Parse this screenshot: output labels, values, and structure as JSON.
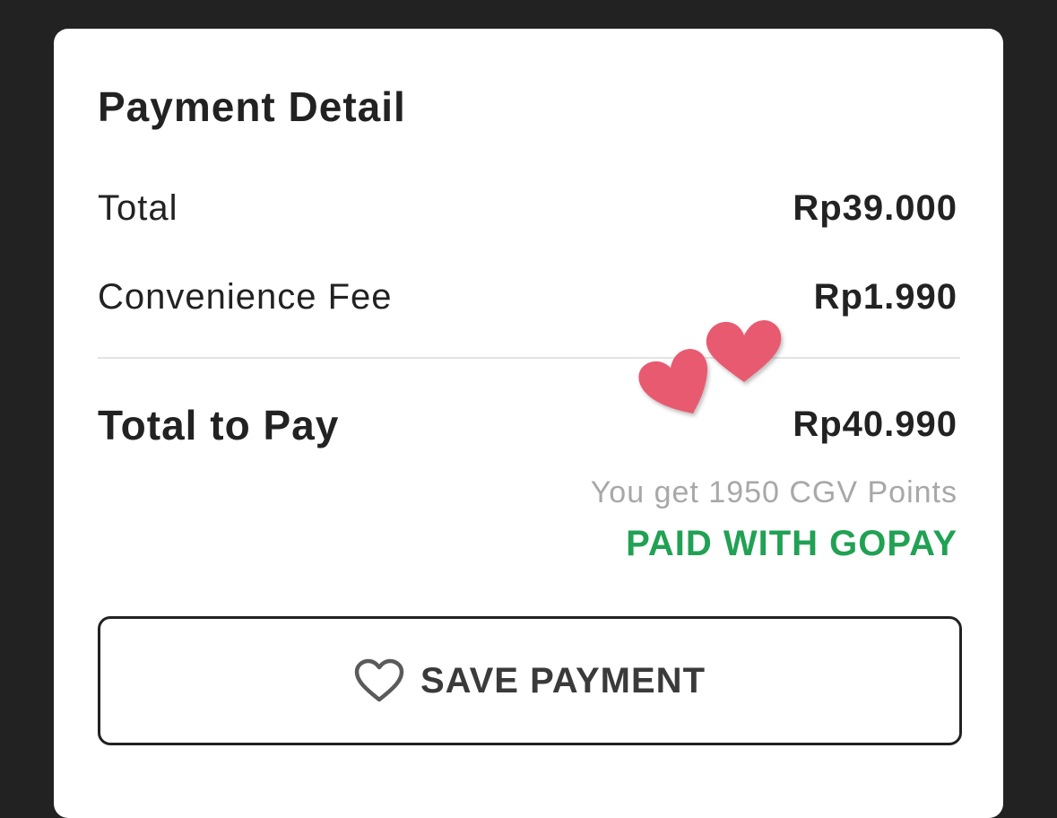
{
  "payment": {
    "title": "Payment Detail",
    "rows": [
      {
        "label": "Total",
        "value": "Rp39.000"
      },
      {
        "label": "Convenience Fee",
        "value": "Rp1.990"
      }
    ],
    "total_label": "Total to Pay",
    "total_value": "Rp40.990",
    "points_text": "You get 1950 CGV Points",
    "paid_text": "PAID WITH GOPAY",
    "save_button": {
      "label": "SAVE PAYMENT",
      "icon": "heart-outline-icon"
    }
  },
  "stickers": {
    "icon": "hearts-sticker-icon",
    "color": "#e85a70"
  },
  "colors": {
    "background": "#222222",
    "card": "#ffffff",
    "text": "#222222",
    "muted": "#a8a8a8",
    "accent_green": "#21a154"
  }
}
